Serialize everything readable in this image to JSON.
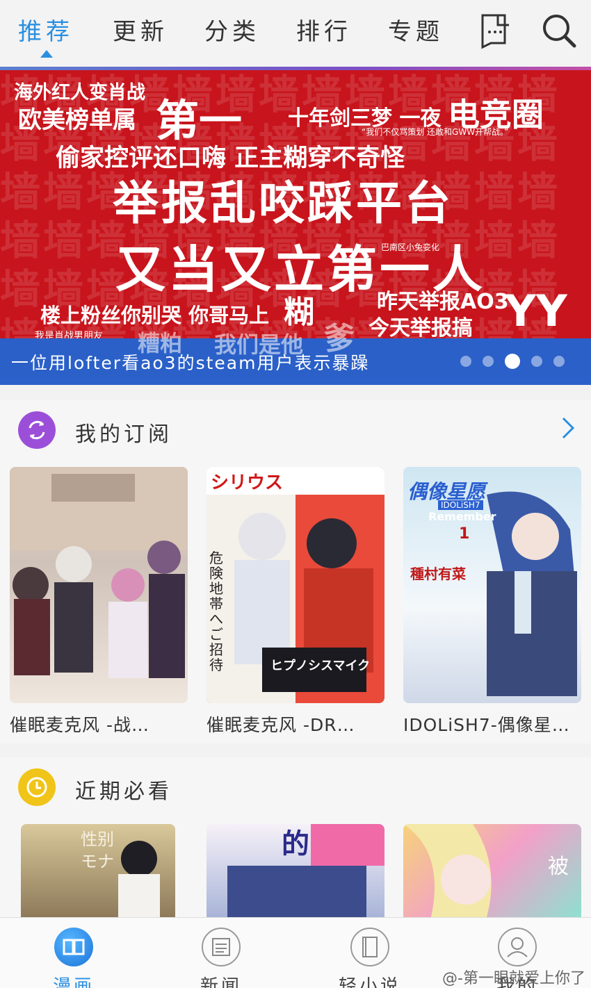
{
  "top_nav": {
    "tabs": [
      "推荐",
      "更新",
      "分类",
      "排行",
      "专题"
    ],
    "active_tab": "推荐"
  },
  "banner": {
    "lines": [
      "海外红人变肖战",
      "欧美榜单属",
      "第一",
      "十年剑三梦 一夜",
      "电竞圈",
      "“我们不仅骂策划 还敢和GWW开帮战。”",
      "偷家控评还口嗨  正主糊穿不奇怪",
      "举报乱咬踩平台",
      "又当又立第一人",
      "巴南区小兔娈化",
      "昨天举报AO3",
      "楼上粉丝你别哭 你哥马上",
      "糊",
      "今天举报搞",
      "YY",
      "我是肖战男朋友",
      "糟粕",
      "我们是他",
      "爹"
    ],
    "background_word": "墙",
    "caption": "一位用lofter看ao3的steam用户表示暴躁",
    "dots_total": 5,
    "dots_active": 3
  },
  "section_subscriptions": {
    "title": "我的订阅",
    "cards": [
      {
        "title": "催眠麦克风 -战…"
      },
      {
        "title": "催眠麦克风 -DR…"
      },
      {
        "title": "IDOLiSH7-偶像星…"
      }
    ],
    "cover_texts": {
      "magazine": "シリウス",
      "idolish_title": "偶像星愿",
      "idolish_sub": "IDOLiSH7",
      "idolish_remember": "Remember",
      "idolish_volume": "1",
      "idolish_author": "種村有菜",
      "hypmic_side": "危険地帯へご招待",
      "hypmic_logo": "ヒプノシスマイク"
    }
  },
  "section_recent": {
    "title": "近期必看",
    "cover_texts": {
      "first": "性别 モナ",
      "second": "的",
      "third": "被"
    }
  },
  "bottom_nav": {
    "items": [
      "漫画",
      "新闻",
      "轻小说",
      "我的"
    ],
    "active_item": "漫画"
  },
  "watermark": "@-第一眼就爱上你了"
}
